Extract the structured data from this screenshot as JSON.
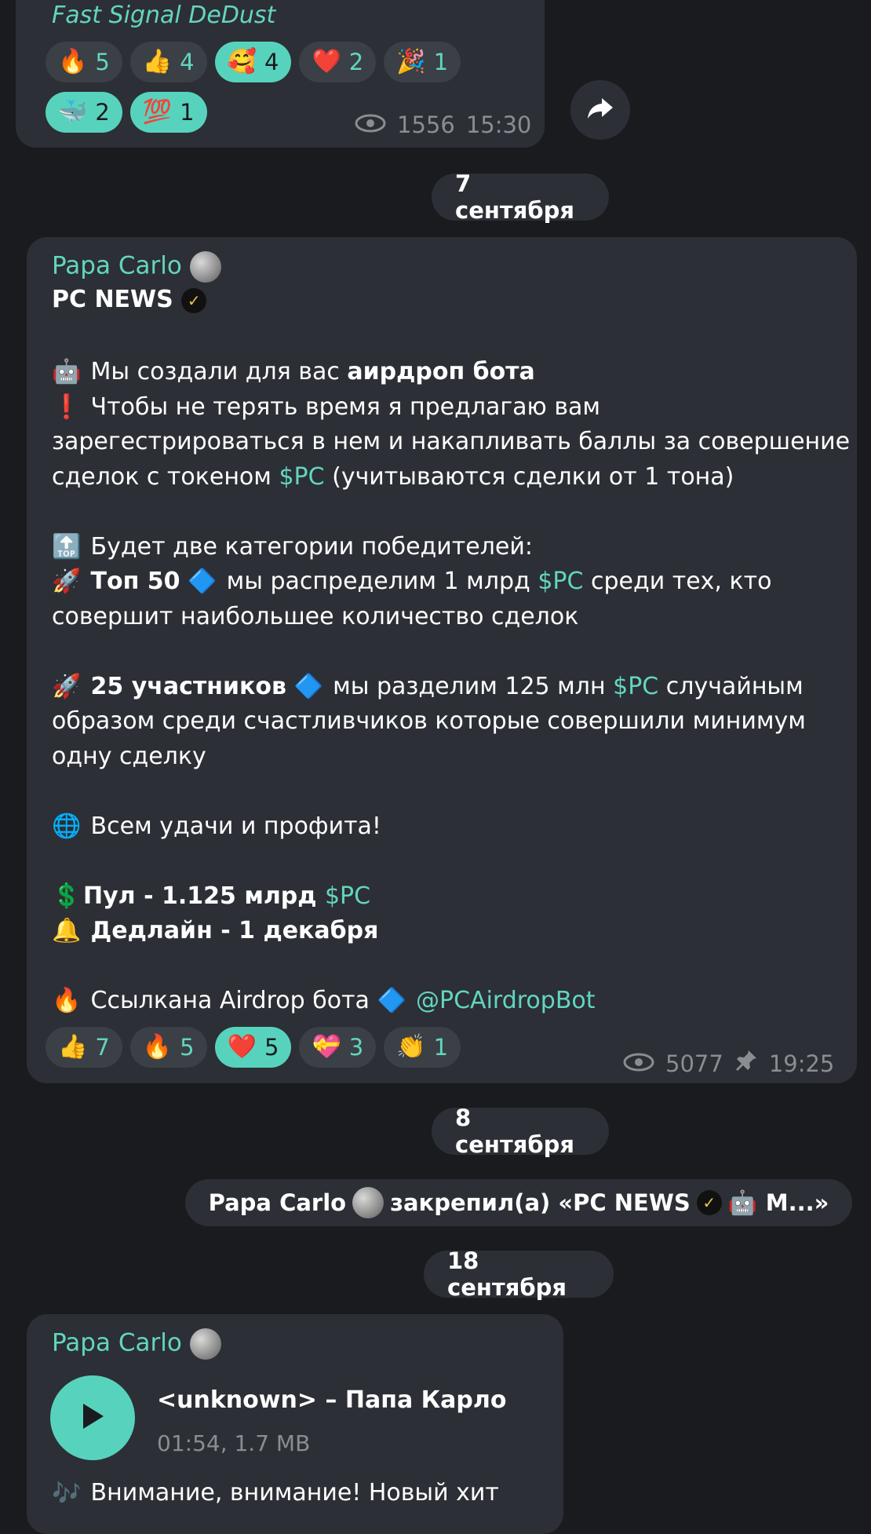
{
  "post1": {
    "signature": "Fast Signal DeDust",
    "reactions_row1": [
      {
        "emoji": "🔥",
        "count": "5",
        "active": false
      },
      {
        "emoji": "👍",
        "count": "4",
        "active": false
      },
      {
        "emoji": "🥰",
        "count": "4",
        "active": true
      },
      {
        "emoji": "❤️",
        "count": "2",
        "active": false
      },
      {
        "emoji": "🎉",
        "count": "1",
        "active": false
      }
    ],
    "reactions_row2": [
      {
        "emoji": "🐳",
        "count": "2",
        "active": true
      },
      {
        "emoji": "💯",
        "count": "1",
        "active": true
      }
    ],
    "views": "1556",
    "time": "15:30"
  },
  "date1": "7 сентября",
  "post2": {
    "author": "Papa Carlo",
    "channel_title": "PC NEWS",
    "lines": {
      "l1_pre": "Мы создали для вас ",
      "l1_bold": "аирдроп бота",
      "l2": "Чтобы не терять время я предлагаю вам",
      "l3": "зарегестрироваться в нем и накапливать баллы за совершение",
      "l4_pre": "сделок с токеном ",
      "l4_tag": "$PC",
      "l4_post": " (учитываются сделки от 1 тона)",
      "l5": "Будет две категории победителей:",
      "l6_bold": "Топ 50",
      "l6_mid": " мы распределим 1 млрд ",
      "l6_tag": "$PC",
      "l6_post": " среди тех, кто",
      "l7": "совершит наибольшее количество сделок",
      "l8_bold": "25 участников",
      "l8_mid": " мы разделим 125 млн ",
      "l8_tag": "$PC",
      "l8_post": " случайным",
      "l9": "образом среди счастливчиков которые совершили минимум",
      "l10": "одну сделку",
      "l11": "Всем удачи и профита!",
      "l12_bold": "Пул - 1.125 млрд ",
      "l12_tag": "$PC",
      "l13_bold": "Дедлайн - 1 декабря",
      "l14_pre": "Ссылкана Airdrop бота",
      "l14_link": "@PCAirdropBot"
    },
    "reactions": [
      {
        "emoji": "👍",
        "count": "7",
        "active": false
      },
      {
        "emoji": "🔥",
        "count": "5",
        "active": false
      },
      {
        "emoji": "❤️",
        "count": "5",
        "active": true
      },
      {
        "emoji": "💝",
        "count": "3",
        "active": false
      },
      {
        "emoji": "👏",
        "count": "1",
        "active": false
      }
    ],
    "views": "5077",
    "time": "19:25"
  },
  "date2": "8 сентября",
  "service": {
    "author": "Papa Carlo",
    "action": "закрепил(а) «PC NEWS",
    "trail": "М...»"
  },
  "date3": "18 сентября",
  "post3": {
    "author": "Papa Carlo",
    "audio_title": "<unknown> – Папа Карло",
    "audio_meta": "01:54, 1.7 MB",
    "caption": "Внимание, внимание! Новый хит"
  }
}
